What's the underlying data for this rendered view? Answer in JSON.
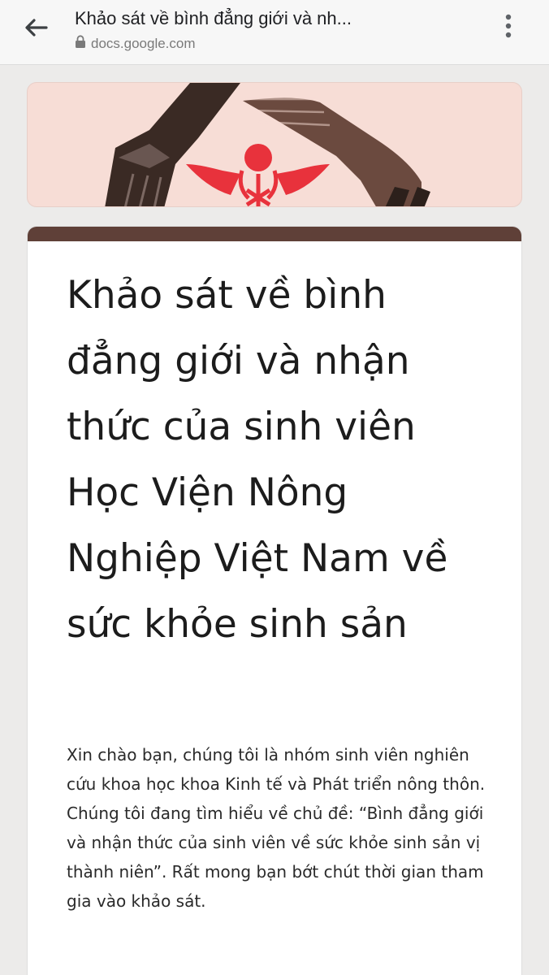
{
  "browser": {
    "page_title": "Khảo sát về bình đẳng giới và nh...",
    "url": "docs.google.com",
    "icons": [
      "back-arrow-icon",
      "lock-icon",
      "more-vert-icon"
    ]
  },
  "form": {
    "title": "Khảo sát về bình đẳng giới và nhận thức của sinh viên Học Viện Nông Nghiệp Việt Nam về sức khỏe sinh sản",
    "description": "Xin chào bạn, chúng tôi là nhóm sinh viên nghiên cứu khoa học khoa Kinh tế và Phát triển nông thôn. Chúng tôi đang tìm hiểu về chủ đề: “Bình đẳng giới và nhận thức của sinh viên về sức khỏe sinh sản vị thành niên”. Rất mong bạn bớt chút thời gian tham gia vào khảo sát."
  },
  "colors": {
    "accent": "#5f4038",
    "banner_bg": "#f7ddd6",
    "logo_red": "#e8323c",
    "hand_dark": "#3a2a24",
    "hand_brown": "#6b4a3f"
  }
}
